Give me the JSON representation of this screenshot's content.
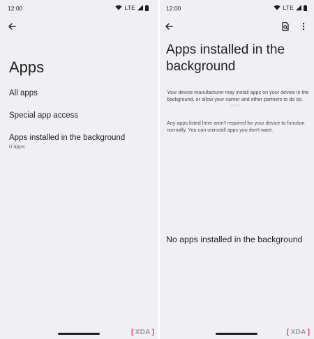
{
  "left": {
    "status": {
      "time": "12:00",
      "network": "LTE"
    },
    "title": "Apps",
    "items": [
      {
        "label": "All apps"
      },
      {
        "label": "Special app access"
      },
      {
        "label": "Apps installed in the background",
        "sub": "0 apps"
      }
    ],
    "watermark": "[XDA]",
    "logo": {
      "bracket_left": "[",
      "bracket_right": "]",
      "text": "XDA"
    }
  },
  "right": {
    "status": {
      "time": "12:00",
      "network": "LTE"
    },
    "title": "Apps installed in the background",
    "paragraph1": "Your device manufacturer may install apps on your device in the background, or allow your carrier and other partners to do so.",
    "paragraph2": "Any apps listed here aren't required for your device to function normally. You can uninstall apps you don't want.",
    "empty_message": "No apps installed in the background",
    "watermark": "[XDA]",
    "logo": {
      "bracket_left": "[",
      "bracket_right": "]",
      "text": "XDA"
    }
  },
  "colors": {
    "background": "#f0eff3",
    "text": "#1f1f1f",
    "secondary_text": "#4a4a4f",
    "xda_accent": "#e3366a"
  },
  "icons": [
    "wifi-icon",
    "signal-icon",
    "battery-icon",
    "back-arrow-icon",
    "search-doc-icon",
    "more-vert-icon"
  ]
}
